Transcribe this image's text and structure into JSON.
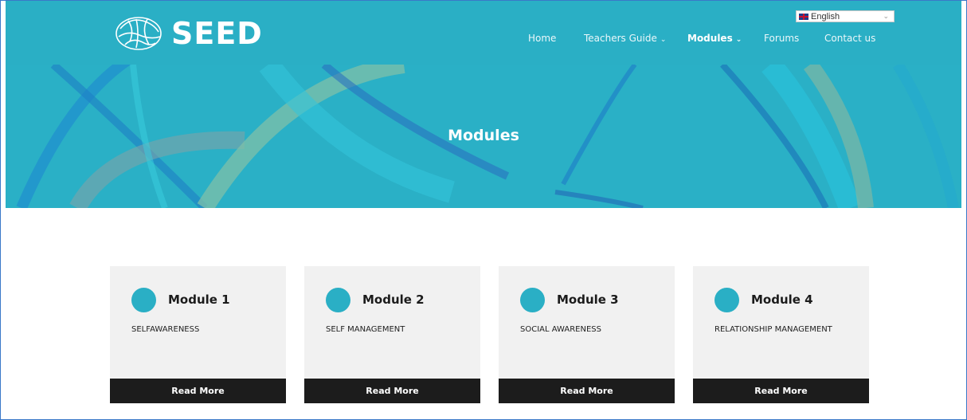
{
  "brand": {
    "logo_icon": "brain-logo-icon",
    "name": "SEED"
  },
  "nav": {
    "home": "Home",
    "teachers_guide": "Teachers Guide",
    "modules": "Modules",
    "forums": "Forums",
    "contact": "Contact us"
  },
  "language": {
    "selected": "English",
    "flag_icon": "uk-flag-icon"
  },
  "hero": {
    "title": "Modules"
  },
  "modules": [
    {
      "title": "Module 1",
      "subtitle": "SELFAWARENESS",
      "button": "Read More"
    },
    {
      "title": "Module 2",
      "subtitle": "SELF MANAGEMENT",
      "button": "Read More"
    },
    {
      "title": "Module 3",
      "subtitle": "SOCIAL AWARENESS",
      "button": "Read More"
    },
    {
      "title": "Module 4",
      "subtitle": "RELATIONSHIP MANAGEMENT",
      "button": "Read More"
    }
  ],
  "colors": {
    "accent": "#2aafc5",
    "button_bg": "#1c1c1c",
    "card_bg": "#f1f1f1"
  }
}
